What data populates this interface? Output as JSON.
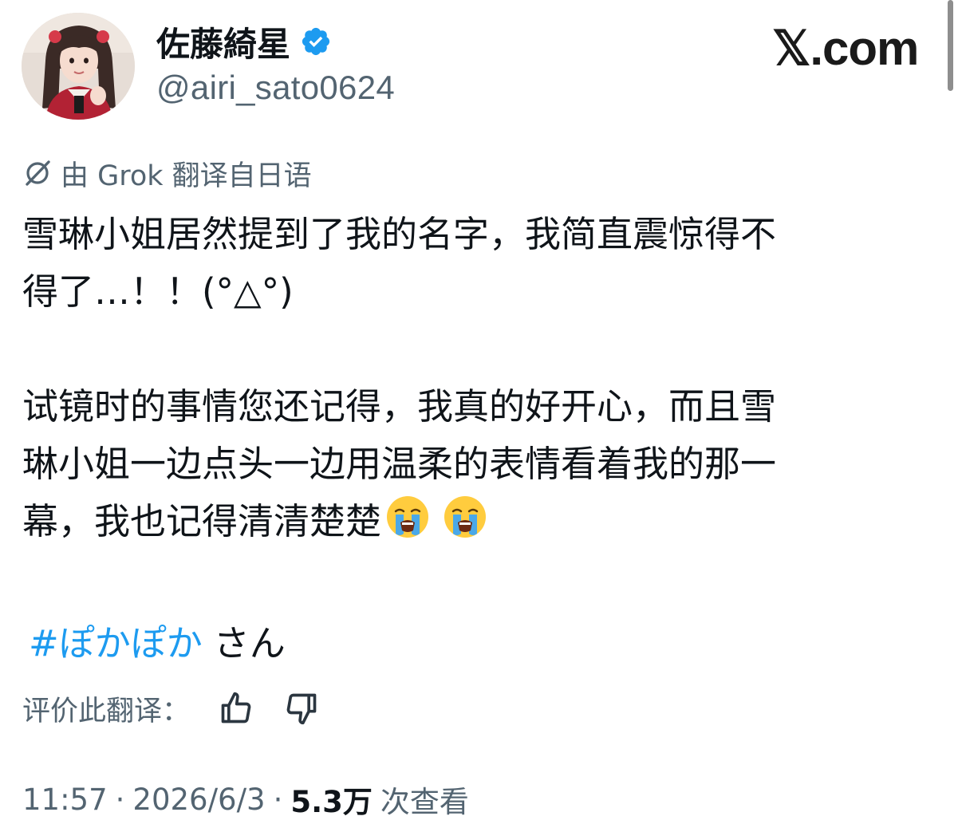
{
  "brand": {
    "label": "𝕏.com"
  },
  "author": {
    "display_name": "佐藤綺星",
    "handle": "@airi_sato0624",
    "verified_color": "#1d9bf0",
    "avatar_icon": "profile-photo"
  },
  "translation": {
    "icon": "grok-icon",
    "note": "由 Grok 翻译自日语"
  },
  "tweet": {
    "lines": [
      "雪琳小姐居然提到了我的名字，我简直震惊得不",
      "得了…！！(°△°)",
      "试镜时的事情您还记得，我真的好开心，而且雪",
      "琳小姐一边点头一边用温柔的表情看着我的那一",
      "幕，我也记得清清楚楚"
    ],
    "emojis": [
      "loudly-crying-face",
      "loudly-crying-face"
    ],
    "hashtag": "#ぽかぽか",
    "hashtag_suffix": "さん"
  },
  "rating": {
    "label": "评价此翻译：",
    "up_icon": "thumbs-up-icon",
    "down_icon": "thumbs-down-icon"
  },
  "meta": {
    "time": "11:57",
    "separator": "·",
    "date": "2026/6/3",
    "views_count": "5.3万",
    "views_label": "次查看"
  },
  "colors": {
    "secondary_text": "#536471",
    "primary_text": "#0f1419",
    "link": "#1d9bf0"
  }
}
